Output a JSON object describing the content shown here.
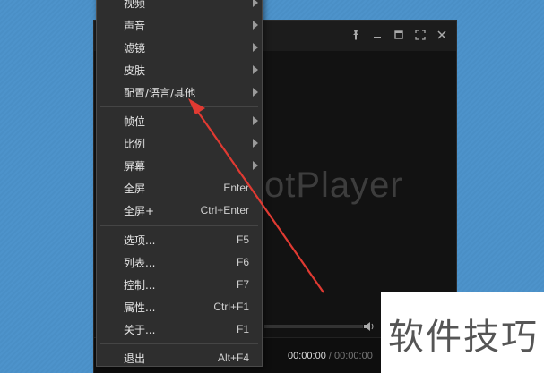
{
  "player": {
    "watermark": "otPlayer",
    "controls": {
      "pin_icon": "pin-icon",
      "minimize_icon": "minimize-icon",
      "maximize_icon": "maximize-icon",
      "fullscreen_icon": "fullscreen-icon",
      "close_icon": "close-icon"
    },
    "time_current": "00:00:00",
    "time_sep": " / ",
    "time_total": "00:00:00"
  },
  "menu": {
    "items": [
      {
        "label": "视频",
        "shortcut": "",
        "submenu": true
      },
      {
        "label": "声音",
        "shortcut": "",
        "submenu": true
      },
      {
        "label": "滤镜",
        "shortcut": "",
        "submenu": true
      },
      {
        "label": "皮肤",
        "shortcut": "",
        "submenu": true
      },
      {
        "label": "配置/语言/其他",
        "shortcut": "",
        "submenu": true
      },
      {
        "label": "帧位",
        "shortcut": "",
        "submenu": true
      },
      {
        "label": "比例",
        "shortcut": "",
        "submenu": true
      },
      {
        "label": "屏幕",
        "shortcut": "",
        "submenu": true
      },
      {
        "label": "全屏",
        "shortcut": "Enter",
        "submenu": false
      },
      {
        "label": "全屏+",
        "shortcut": "Ctrl+Enter",
        "submenu": false
      },
      {
        "label": "选项...",
        "shortcut": "F5",
        "submenu": false
      },
      {
        "label": "列表...",
        "shortcut": "F6",
        "submenu": false
      },
      {
        "label": "控制...",
        "shortcut": "F7",
        "submenu": false
      },
      {
        "label": "属性...",
        "shortcut": "Ctrl+F1",
        "submenu": false
      },
      {
        "label": "关于...",
        "shortcut": "F1",
        "submenu": false
      },
      {
        "label": "退出",
        "shortcut": "Alt+F4",
        "submenu": false
      }
    ]
  },
  "annotation": {
    "arrow_color": "#e03a32"
  },
  "brand": {
    "text": "软件技巧"
  }
}
